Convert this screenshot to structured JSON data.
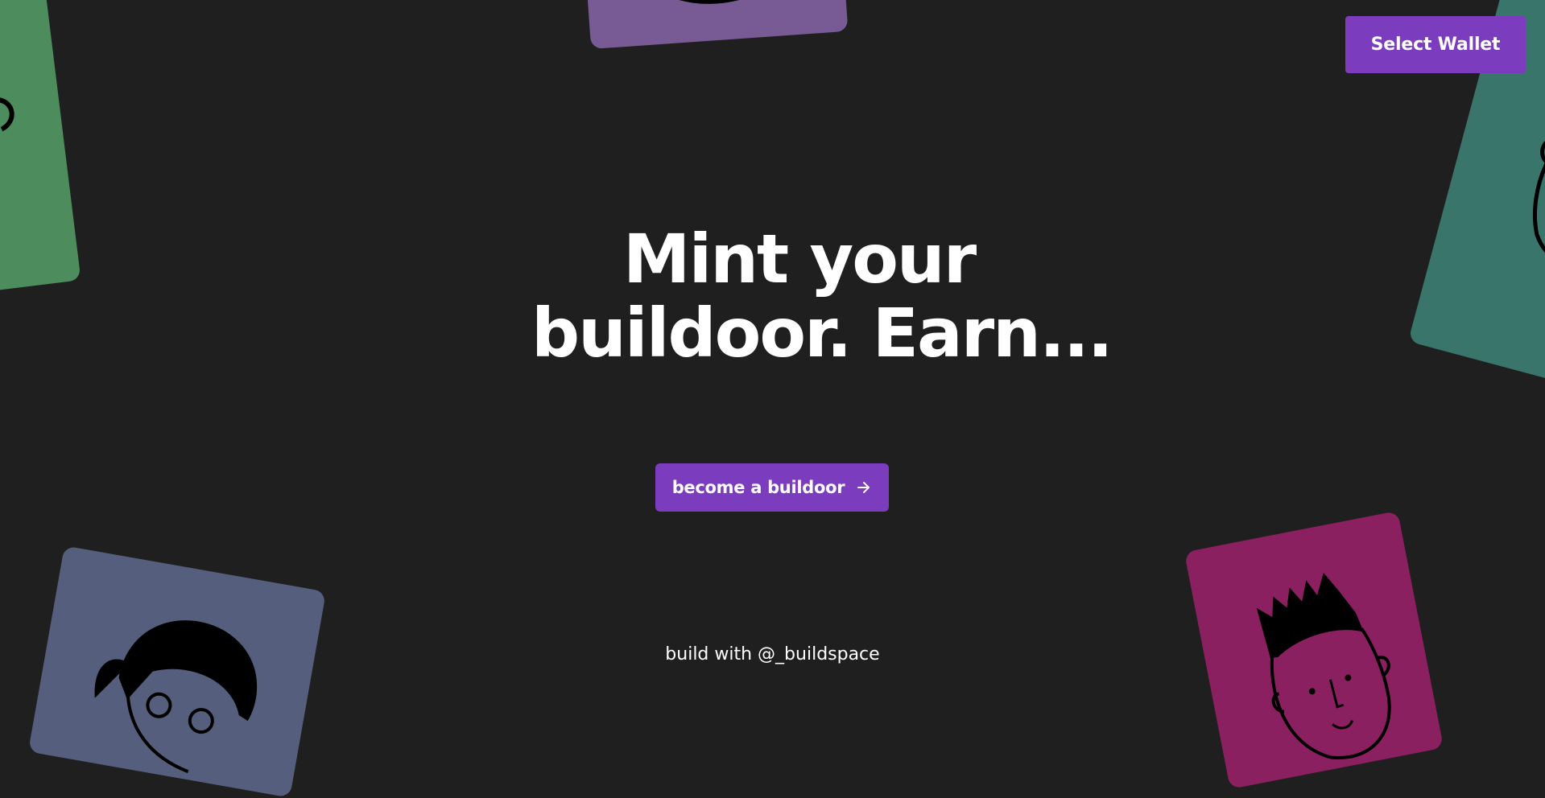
{
  "header": {
    "wallet_button_label": "Select Wallet"
  },
  "hero": {
    "title_line1": "Mint your",
    "title_line2": "buildoor. Earn...",
    "cta_label": "become a buildoor"
  },
  "footer": {
    "credit": "build with @_buildspace"
  },
  "icons": {
    "cta_icon": "arrow-right-icon"
  },
  "colors": {
    "background": "#1f1f1f",
    "accent": "#7b3cbd",
    "text": "#ffffff",
    "card_purple": "#785a94",
    "card_green": "#4d8c5c",
    "card_teal": "#3a756c",
    "card_slate": "#555e7c",
    "card_magenta": "#8b2060"
  }
}
